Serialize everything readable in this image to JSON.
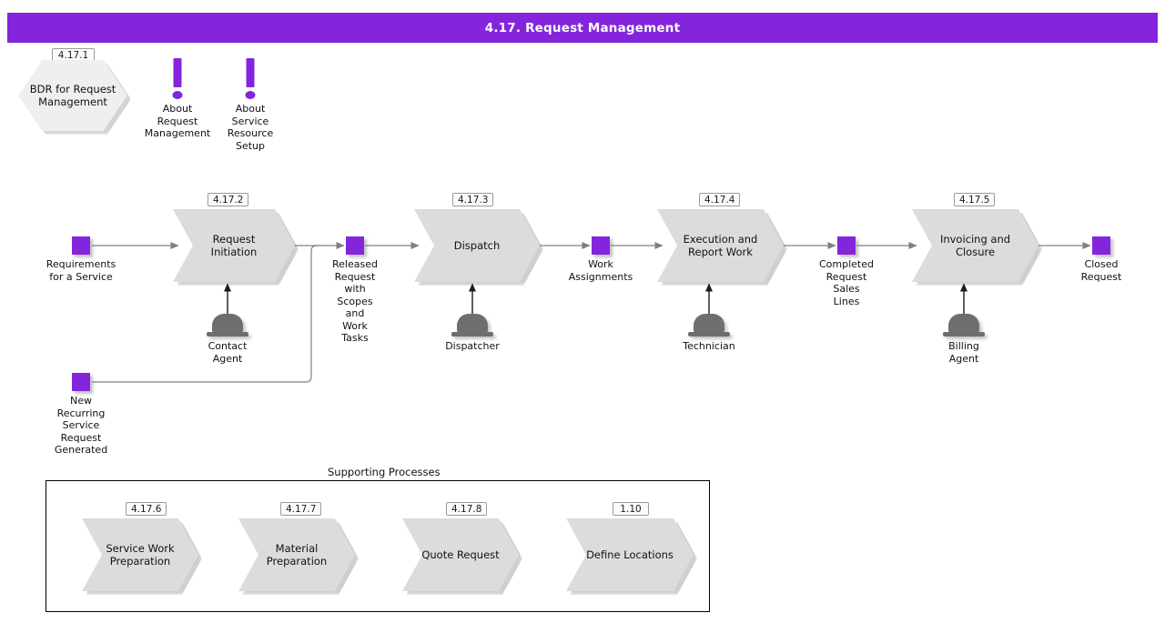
{
  "colors": {
    "accent": "#8425dd",
    "process_fill": "#dcdcdc",
    "hex_fill": "#efefef",
    "role_fill": "#6e6e6e",
    "connector": "#808080",
    "title_text": "#ffffff"
  },
  "header": {
    "title": "4.17. Request Management"
  },
  "bdr": {
    "badge": "4.17.1",
    "label": "BDR for Request\nManagement"
  },
  "info_icons": [
    {
      "name": "about-request-management",
      "label": "About\nRequest\nManagement"
    },
    {
      "name": "about-service-resource-setup",
      "label": "About\nService\nResource\nSetup"
    }
  ],
  "main_flow": {
    "data_nodes": [
      {
        "name": "requirements-for-a-service",
        "label": "Requirements\nfor a Service"
      },
      {
        "name": "released-request",
        "label": "Released\nRequest\nwith Scopes\nand Work\nTasks"
      },
      {
        "name": "work-assignments",
        "label": "Work\nAssignments"
      },
      {
        "name": "completed-request-sales-lines",
        "label": "Completed\nRequest\nSales Lines"
      },
      {
        "name": "closed-request",
        "label": "Closed\nRequest"
      },
      {
        "name": "new-recurring-service-request",
        "label": "New\nRecurring\nService\nRequest\nGenerated"
      }
    ],
    "processes": [
      {
        "badge": "4.17.2",
        "label": "Request\nInitiation"
      },
      {
        "badge": "4.17.3",
        "label": "Dispatch"
      },
      {
        "badge": "4.17.4",
        "label": "Execution and\nReport Work"
      },
      {
        "badge": "4.17.5",
        "label": "Invoicing and\nClosure"
      }
    ],
    "roles": [
      {
        "name": "contact-agent",
        "label": "Contact\nAgent"
      },
      {
        "name": "dispatcher",
        "label": "Dispatcher"
      },
      {
        "name": "technician",
        "label": "Technician"
      },
      {
        "name": "billing-agent",
        "label": "Billing\nAgent"
      }
    ]
  },
  "supporting": {
    "title": "Supporting Processes",
    "processes": [
      {
        "badge": "4.17.6",
        "label": "Service Work\nPreparation"
      },
      {
        "badge": "4.17.7",
        "label": "Material\nPreparation"
      },
      {
        "badge": "4.17.8",
        "label": "Quote Request"
      },
      {
        "badge": "1.10",
        "label": "Define Locations"
      }
    ]
  }
}
